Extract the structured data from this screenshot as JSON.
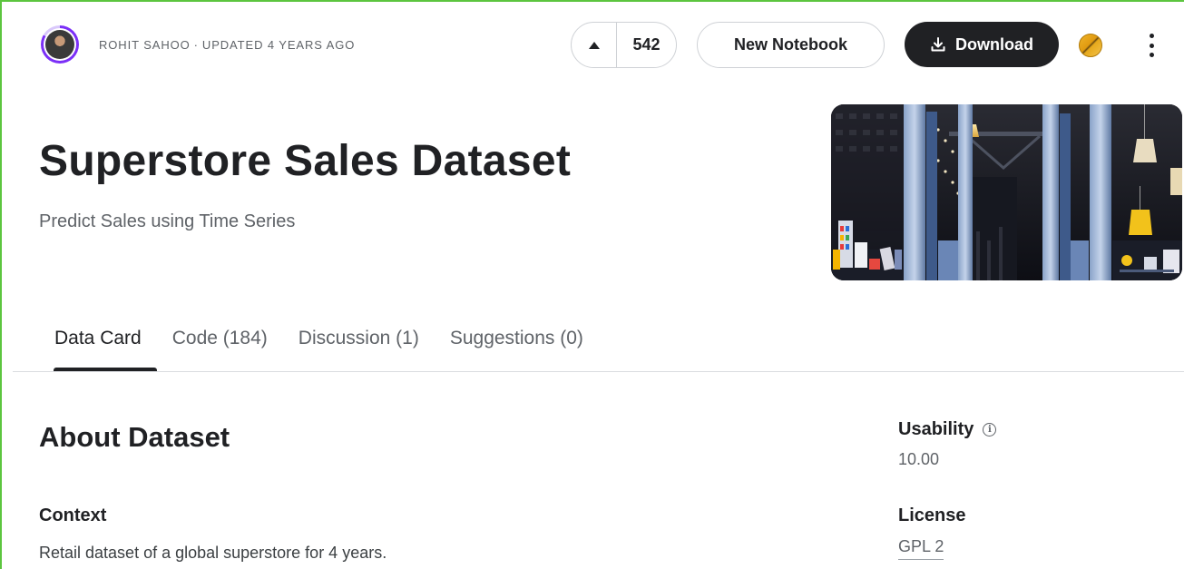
{
  "header": {
    "author": "ROHIT SAHOO",
    "separator": "·",
    "updated": "UPDATED 4 YEARS AGO",
    "vote_count": "542",
    "new_notebook_label": "New Notebook",
    "download_label": "Download"
  },
  "dataset": {
    "title": "Superstore Sales Dataset",
    "subtitle": "Predict Sales using Time Series"
  },
  "tabs": [
    {
      "label": "Data Card",
      "active": true
    },
    {
      "label": "Code (184)",
      "active": false
    },
    {
      "label": "Discussion (1)",
      "active": false
    },
    {
      "label": "Suggestions (0)",
      "active": false
    }
  ],
  "about": {
    "heading": "About Dataset",
    "context_heading": "Context",
    "context_text": "Retail dataset of a global superstore for 4 years."
  },
  "meta": {
    "usability_label": "Usability",
    "usability_value": "10.00",
    "license_label": "License",
    "license_value": "GPL 2"
  },
  "colors": {
    "accent_dark": "#202124",
    "avatar_ring": "#7b2ff7",
    "medal_gold": "#e6a91c",
    "frame_green": "#5cc53f"
  },
  "icons": {
    "upvote": "upvote-arrow-icon",
    "download": "download-icon",
    "medal": "medal-icon",
    "more": "more-vertical-icon",
    "info": "info-icon"
  }
}
